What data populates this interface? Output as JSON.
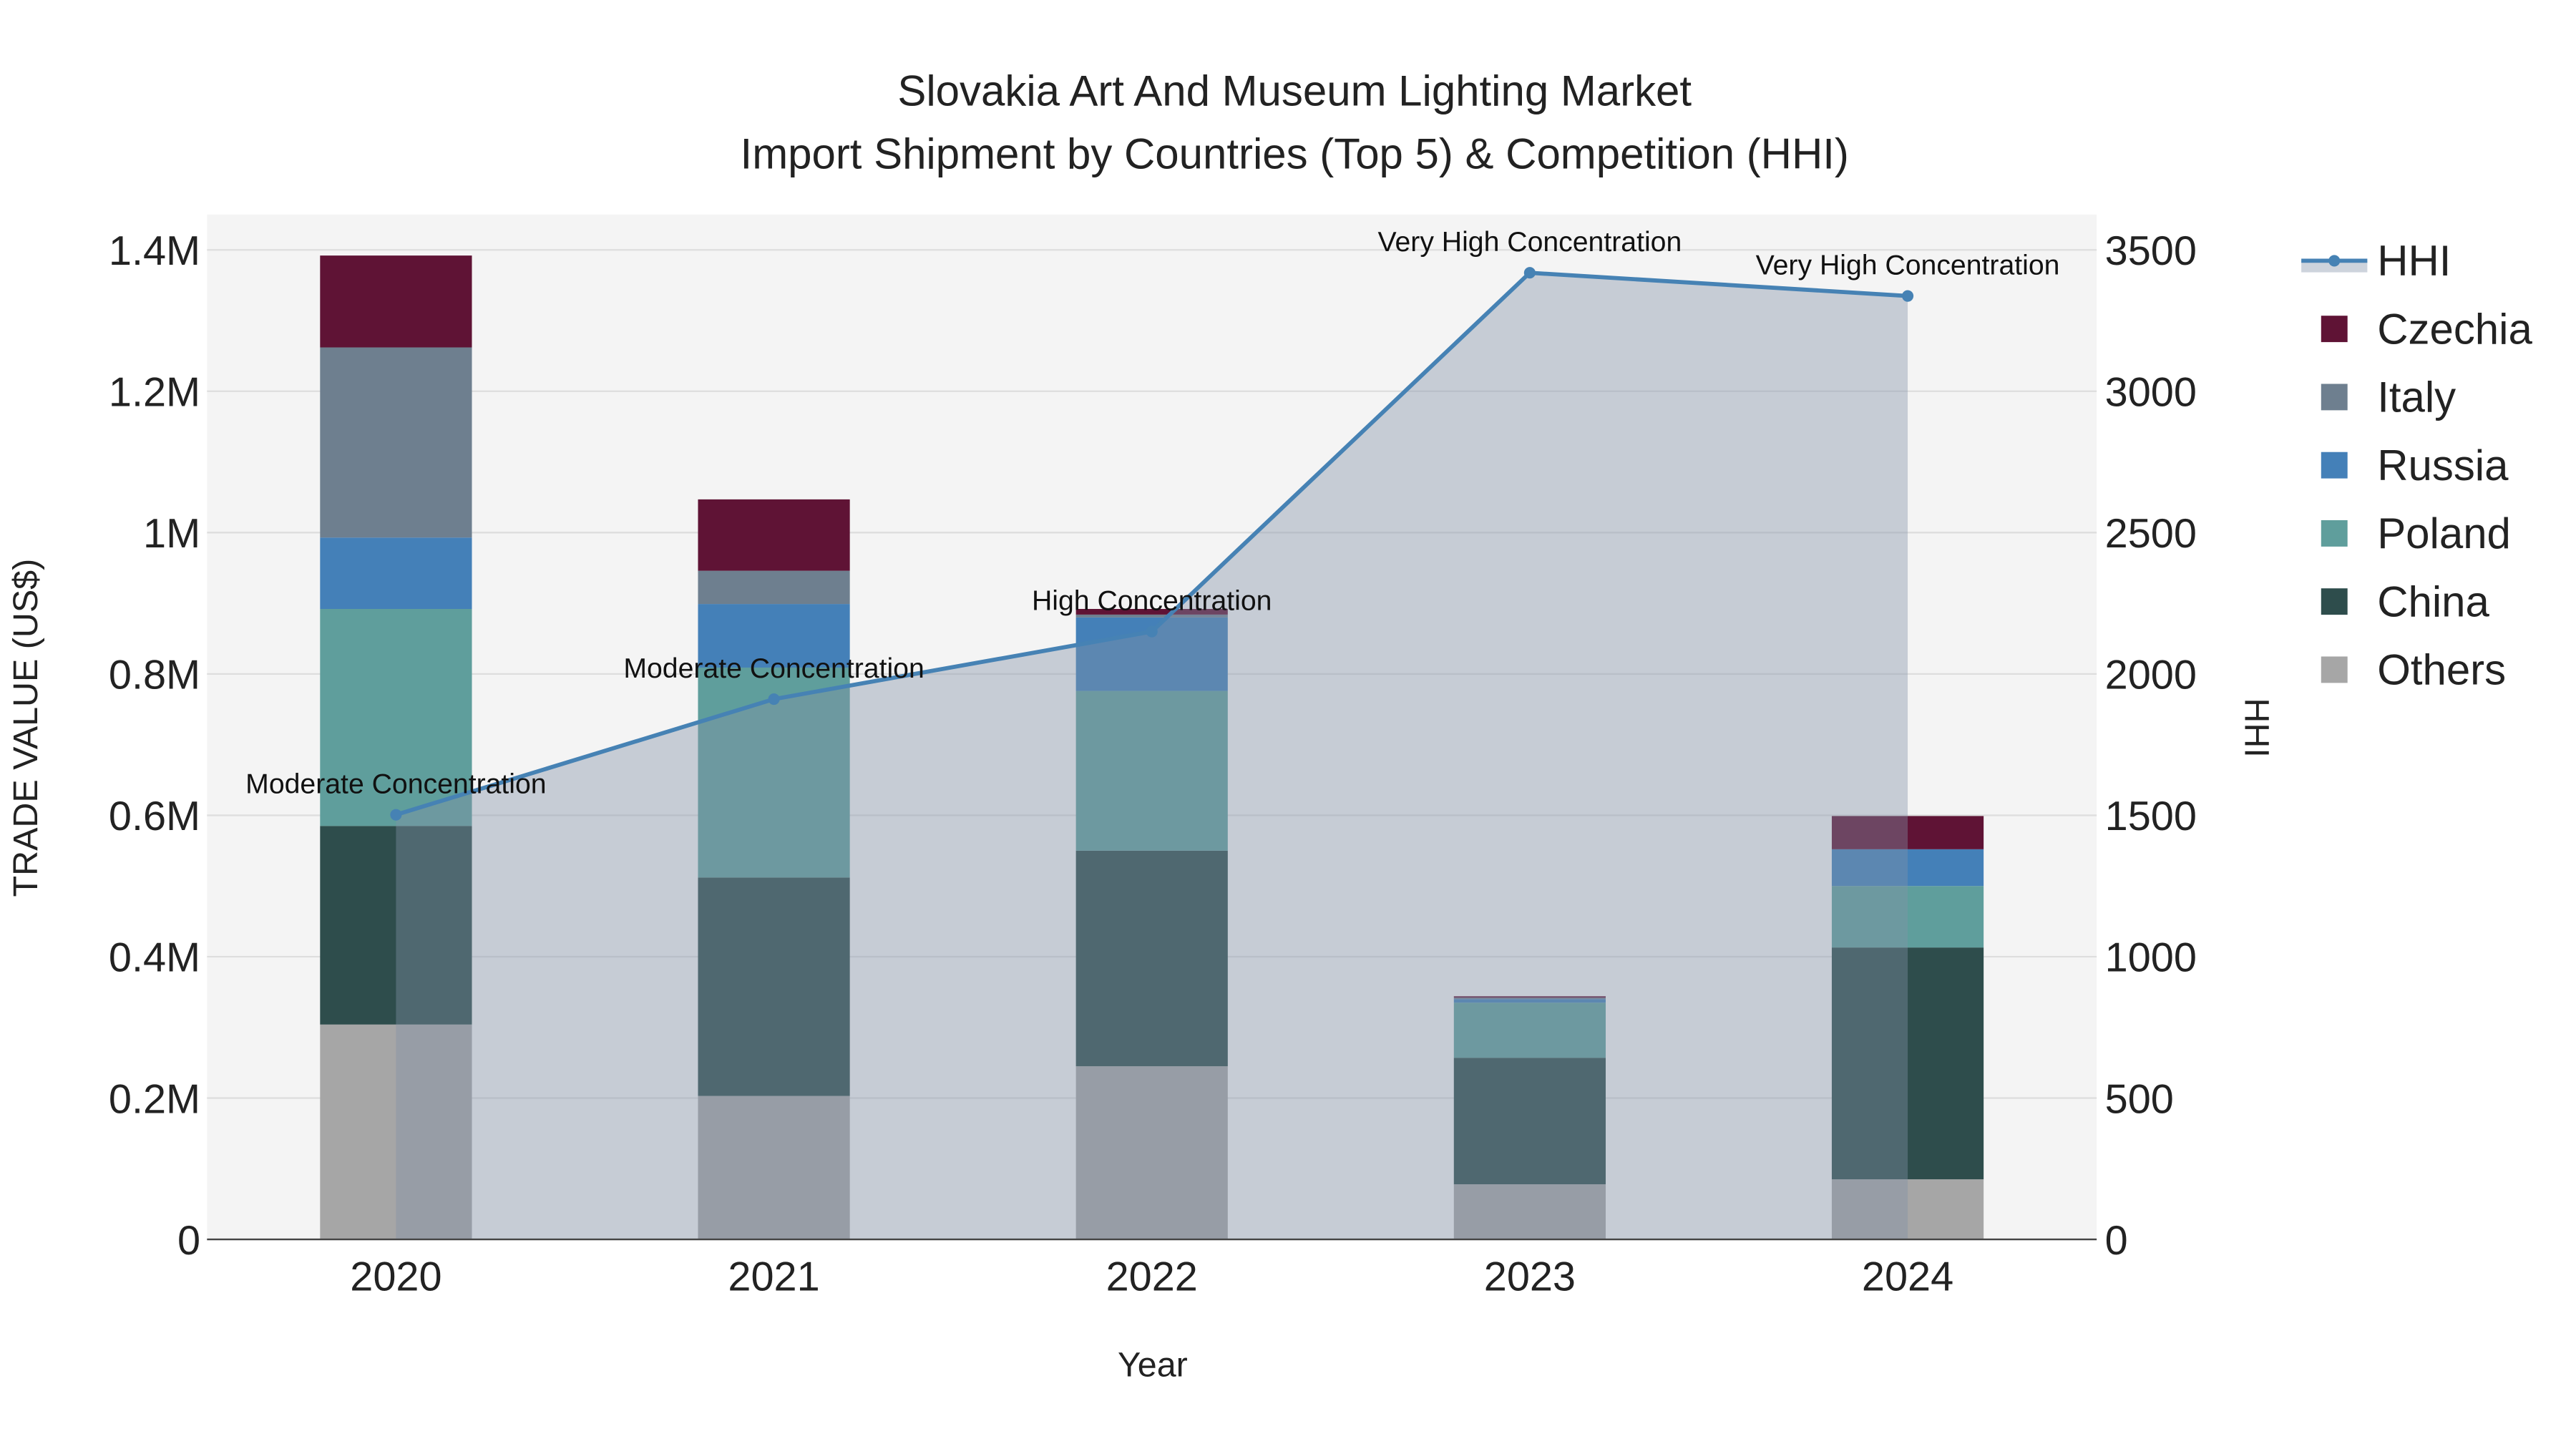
{
  "chart_data": {
    "type": "bar",
    "title": "Slovakia Art And Museum Lighting Market",
    "subtitle": "Import Shipment by Countries (Top 5) & Competition (HHI)",
    "xlabel": "Year",
    "ylabel": "TRADE VALUE (US$)",
    "y2label": "HHI",
    "categories": [
      "2020",
      "2021",
      "2022",
      "2023",
      "2024"
    ],
    "ylim": [
      0,
      1450000
    ],
    "y2lim": [
      0,
      3625
    ],
    "yticks": [
      0,
      200000,
      400000,
      600000,
      800000,
      1000000,
      1200000,
      1400000
    ],
    "ytick_labels": [
      "0",
      "0.2M",
      "0.4M",
      "0.6M",
      "0.8M",
      "1M",
      "1.2M",
      "1.4M"
    ],
    "y2ticks": [
      0,
      500,
      1000,
      1500,
      2000,
      2500,
      3000,
      3500
    ],
    "y2tick_labels": [
      "0",
      "500",
      "1000",
      "1500",
      "2000",
      "2500",
      "3000",
      "3500"
    ],
    "grid": true,
    "legend_position": "right",
    "series": [
      {
        "name": "Others",
        "color": "#a6a6a6",
        "values": [
          304000,
          203000,
          245000,
          78000,
          85000
        ]
      },
      {
        "name": "China",
        "color": "#2e4d4c",
        "values": [
          281000,
          309000,
          305000,
          179000,
          328000
        ]
      },
      {
        "name": "Poland",
        "color": "#5f9e9c",
        "values": [
          307000,
          297000,
          226000,
          78000,
          87000
        ]
      },
      {
        "name": "Russia",
        "color": "#4480b8",
        "values": [
          101000,
          90000,
          104000,
          5000,
          52000
        ]
      },
      {
        "name": "Italy",
        "color": "#6e7f8f",
        "values": [
          269000,
          47000,
          4000,
          2000,
          0
        ]
      },
      {
        "name": "Czechia",
        "color": "#5f1335",
        "values": [
          130000,
          101000,
          8000,
          2000,
          47000
        ]
      }
    ],
    "hhi": {
      "name": "HHI",
      "color": "#4682b4",
      "values": [
        1502,
        1911,
        2150,
        3419,
        3337
      ],
      "annotations": [
        "Moderate Concentration",
        "Moderate Concentration",
        "High Concentration",
        "Very High Concentration",
        "Very High Concentration"
      ]
    },
    "legend": [
      "HHI",
      "Czechia",
      "Italy",
      "Russia",
      "Poland",
      "China",
      "Others"
    ]
  }
}
